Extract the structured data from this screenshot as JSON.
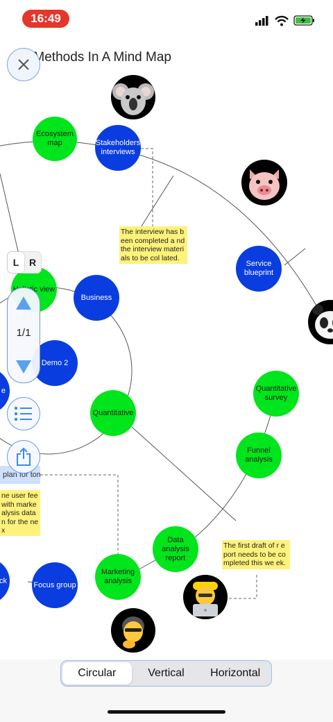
{
  "status_bar": {
    "time": "16:49"
  },
  "title": "Design Methods In A Mind Map",
  "title_visible": "gn Methods In A Mind Map",
  "nodes": {
    "ecosystem_map": "Ecosystem map",
    "stakeholders_interviews": "Stakeholders interviews",
    "service_blueprint": "Service blueprint",
    "holistic_view": "Holistic view",
    "business": "Business",
    "demo2": "Demo 2",
    "quantitative": "Quantitative",
    "quantitative_survey": "Quantitative survey",
    "funnel_analysis": "Funnel analysis",
    "data_analysis_report": "Data analysis report",
    "marketing_analysis": "Marketing analysis",
    "focus_group": "Focus group",
    "left_partial_1": "e",
    "left_partial_2": "ck"
  },
  "notes": {
    "interview": "The interview has been completed and the interview materials to be collated.",
    "interview_display": "The interview has been completed a nd the interview materials to be col lated.",
    "user_feedback_display": "ne user fee with marke alysis data n for the nex",
    "report_display": "The first draft of r eport needs to be completed this we ek.",
    "plan_label": "plan for tom"
  },
  "controls": {
    "lr_left": "L",
    "lr_right": "R",
    "page_indicator": "1/1"
  },
  "layout_modes": {
    "items": [
      "Circular",
      "Vertical",
      "Horizontal"
    ],
    "selected": "Circular"
  },
  "colors": {
    "green_node": "#00e51b",
    "blue_node": "#0a3de0",
    "note_bg": "#fff27a",
    "accent": "#5da0ec",
    "time_pill": "#e5362c"
  }
}
